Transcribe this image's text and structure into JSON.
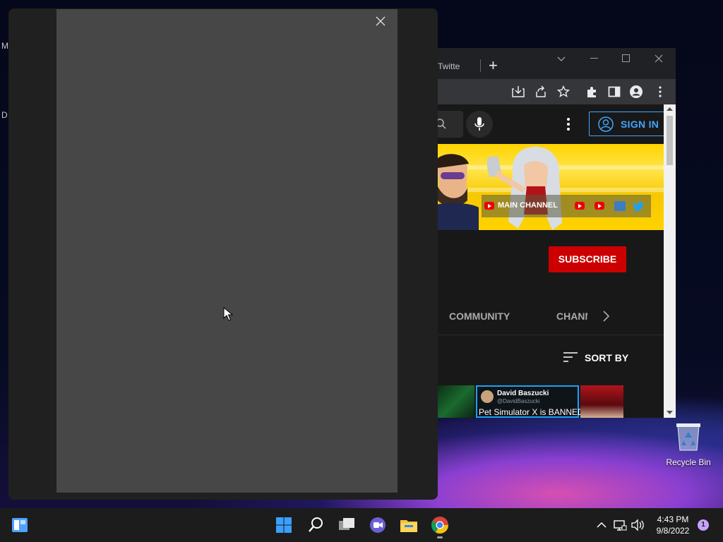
{
  "desktop": {
    "edge_letters": [
      "M",
      "D"
    ],
    "recycle_bin": {
      "label": "Recycle Bin",
      "icon": "recycle-bin-icon"
    }
  },
  "chrome": {
    "tab_title": "Twitte",
    "new_tab_icon": "plus-icon",
    "window_controls": [
      "chevron-down-icon",
      "minimize-icon",
      "maximize-icon",
      "close-icon"
    ],
    "toolbar_icons": [
      "install-icon",
      "share-icon",
      "star-icon",
      "extensions-icon",
      "side-panel-icon",
      "profile-icon",
      "kebab-menu-icon"
    ]
  },
  "youtube": {
    "sign_in_label": "SIGN IN",
    "banner_links_label": "MAIN CHANNEL",
    "subscribe_label": "SUBSCRIBE",
    "tabs": {
      "community": "COMMUNITY",
      "channels": "CHANNELS"
    },
    "sort_label": "SORT BY",
    "tweet": {
      "name": "David Baszucki",
      "handle": "@DavidBaszucki",
      "text": "Pet Simulator X is BANNED"
    },
    "accent": "#3ea6ff",
    "subscribe_color": "#cc0000"
  },
  "overlay": {
    "close_icon": "close-icon"
  },
  "taskbar": {
    "time": "4:43 PM",
    "date": "9/8/2022",
    "notification_count": "1",
    "apps": [
      "widgets-icon",
      "start-icon",
      "search-icon",
      "task-view-icon",
      "chat-icon",
      "file-explorer-icon",
      "chrome-icon"
    ]
  }
}
